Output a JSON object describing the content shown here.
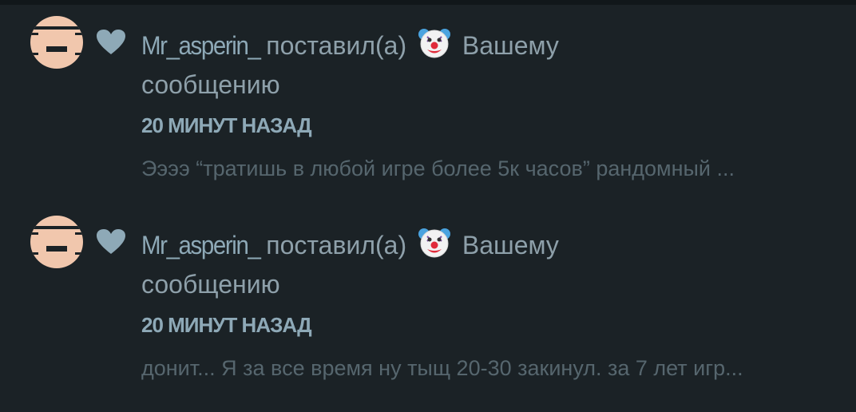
{
  "notifications": [
    {
      "avatar_icon": "user-avatar-icon",
      "reaction_icon": "heart-icon",
      "username": "Mr_asperin_",
      "action": "поставил(а)",
      "emoji": "🤡",
      "target_line1": "Вашему",
      "target_line2": "сообщению",
      "time": "20 МИНУТ НАЗАД",
      "preview": "Ээээ “тратишь в любой игре более 5к часов” рандомный ..."
    },
    {
      "avatar_icon": "user-avatar-icon",
      "reaction_icon": "heart-icon",
      "username": "Mr_asperin_",
      "action": "поставил(а)",
      "emoji": "🤡",
      "target_line1": "Вашему",
      "target_line2": "сообщению",
      "time": "20 МИНУТ НАЗАД",
      "preview": "донит... Я за все время ну тыщ 20-30 закинул. за 7 лет игр..."
    }
  ],
  "colors": {
    "background": "#1b2226",
    "username": "#8ea9b7",
    "text": "#8ea0aa",
    "preview": "#56666e",
    "avatar": "#f1c7ad"
  }
}
